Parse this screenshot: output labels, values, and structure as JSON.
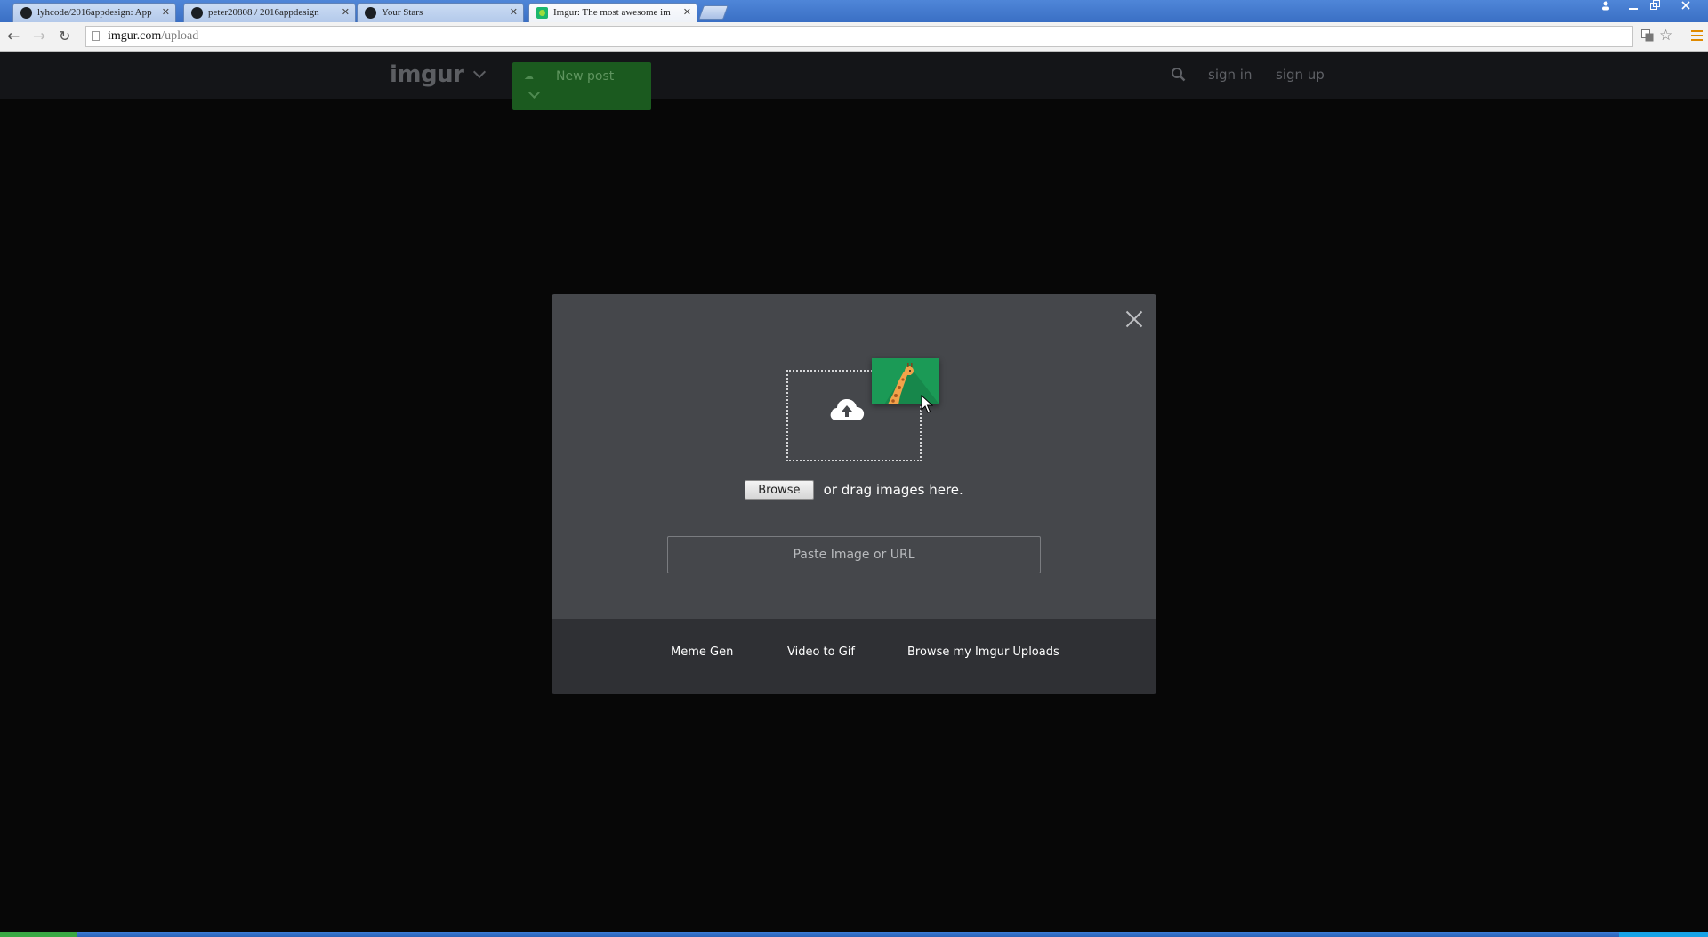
{
  "browser": {
    "tabs": [
      {
        "title": "lyhcode/2016appdesign: App",
        "favicon": "github-icon",
        "active": false
      },
      {
        "title": "peter20808 / 2016appdesign",
        "favicon": "github-icon",
        "active": false
      },
      {
        "title": "Your Stars",
        "favicon": "github-icon",
        "active": false
      },
      {
        "title": "Imgur: The most awesome im",
        "favicon": "imgur-icon",
        "active": true
      }
    ],
    "tab_close": "✕",
    "url_host": "imgur.com",
    "url_path": "/upload"
  },
  "header": {
    "logo": "imgur",
    "new_post": "New post",
    "sign_in": "sign in",
    "sign_up": "sign up"
  },
  "upload": {
    "browse": "Browse",
    "drag_text": "or drag images here.",
    "paste_placeholder": "Paste Image or URL"
  },
  "footer": {
    "links": [
      "Meme Gen",
      "Video to Gif",
      "Browse my Imgur Uploads"
    ]
  },
  "colors": {
    "page_bg": "#070707",
    "header_bg": "#141518",
    "new_post_green": "#1b5a1f",
    "modal_body": "#45474b",
    "modal_footer": "#2f3034",
    "photo_green": "#1b9a56"
  }
}
